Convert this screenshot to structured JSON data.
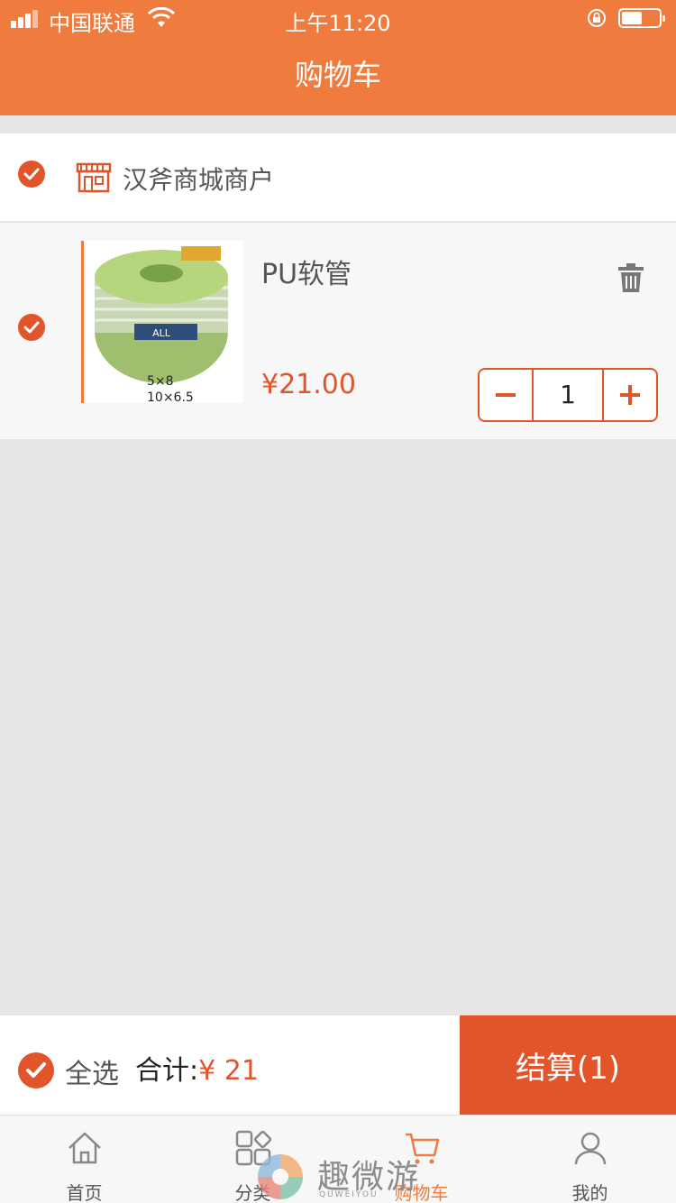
{
  "status_bar": {
    "carrier": "中国联通",
    "time": "上午11:20"
  },
  "header": {
    "title": "购物车"
  },
  "shop": {
    "name": "汉斧商城商户",
    "selected": true
  },
  "cart_item": {
    "name": "PU软管",
    "price": "¥21.00",
    "quantity": "1",
    "selected": true,
    "image_labels": [
      "5×8",
      "10×6.5"
    ]
  },
  "summary": {
    "select_all_label": "全选",
    "total_label": "合计:",
    "total_amount": "¥ 21",
    "checkout_label": "结算(1)"
  },
  "tabbar": {
    "tabs": [
      {
        "label": "首页",
        "icon": "home-icon",
        "active": false
      },
      {
        "label": "分类",
        "icon": "category-icon",
        "active": false
      },
      {
        "label": "购物车",
        "icon": "cart-icon",
        "active": true
      },
      {
        "label": "我的",
        "icon": "profile-icon",
        "active": false
      }
    ]
  },
  "watermark": {
    "text": "趣微游",
    "sub": "QUWEIYOU"
  },
  "colors": {
    "header": "#f07b3f",
    "accent": "#e2552b",
    "background": "#e6e6e6"
  }
}
